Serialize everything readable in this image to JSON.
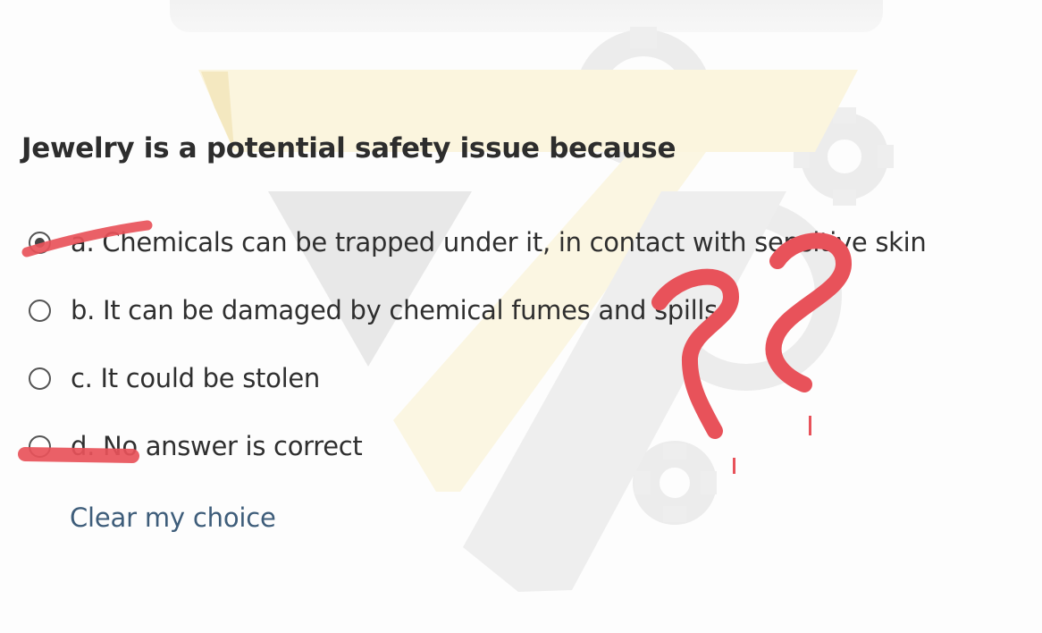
{
  "question": {
    "text": "Jewelry is a potential safety issue because"
  },
  "options": [
    {
      "label": "a. Chemicals can be trapped under it, in contact with sensitive skin",
      "selected": true
    },
    {
      "label": "b. It can be damaged by chemical fumes and spills",
      "selected": false
    },
    {
      "label": "c. It could be stolen",
      "selected": false
    },
    {
      "label": "d. No answer is correct",
      "selected": false
    }
  ],
  "clear_choice_label": "Clear my choice",
  "annotation": {
    "marks": "red strike-through on options a and d, two red question marks",
    "color": "#e8525a"
  },
  "colors": {
    "text": "#2d2d2d",
    "link": "#3e5d7a",
    "annotation": "#e8525a"
  }
}
